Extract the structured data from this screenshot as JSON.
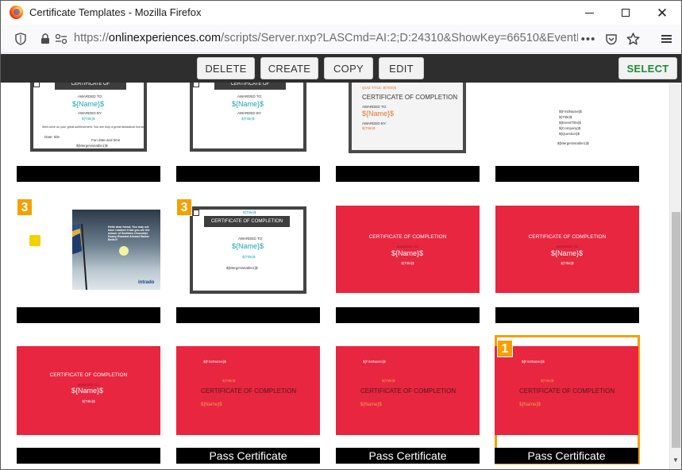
{
  "window": {
    "title": "Certificate Templates - Mozilla Firefox",
    "min_icon": "minimize-icon",
    "max_icon": "maximize-icon",
    "close_icon": "close-icon"
  },
  "navbar": {
    "url_prefix": "https://",
    "url_host": "onlinexperiences.com",
    "url_path": "/scripts/Server.nxp?LASCmd=AI:2;D:24310&ShowKey=66510&EventKey=N",
    "more": "•••"
  },
  "toolbar": {
    "delete": "DELETE",
    "create": "CREATE",
    "copy": "COPY",
    "edit": "EDIT",
    "select": "SELECT"
  },
  "colors": {
    "red_template": "#e8263f",
    "badge": "#f5a000",
    "toolbar": "#2e2e2e",
    "select_text": "#1f8a3a"
  },
  "tiles": {
    "r1c1": {
      "cert_title": "CERTIFICATE OF COMPLETION",
      "awarded": "AWARDED TO:",
      "name": "${Name}$",
      "by": "AWARDED BY",
      "title": "${Title}$",
      "body": "Well done on your great achievement. You are truly a great fantastical human.",
      "merge": "${MergeVariable1}$",
      "date": "Date: title",
      "fun": "Fun date and time"
    },
    "r1c2": {
      "cert_title": "CERTIFICATE OF COMPLETION",
      "awarded": "AWARDED TO:",
      "name": "${Name}$",
      "by": "AWARDED BY",
      "title": "${Title}$"
    },
    "r1c3": {
      "quiz": "QUIZ TITLE: ${Title}$",
      "cert_title": "CERTIFICATE OF COMPLETION",
      "awarded": "AWARDED TO:",
      "name": "${Name}$",
      "by": "AWARDED BY:",
      "title": "${Title}$"
    },
    "r1c4": {
      "lines": [
        "${FirstName}$",
        "${Title}$",
        "${EventTitle}$",
        "${Company}$",
        "${Question}$"
      ],
      "merge": "${MergeVariable1}$"
    },
    "r2c1": {
      "badge": "3",
      "text": "Hello dear friend, You may not have realized it but you are the winner of Smithies Chocolate Honey Roasted Almond Butter Bells!!!",
      "brand": "intrado"
    },
    "r2c2": {
      "badge": "3",
      "cert_title": "CERTIFICATE OF COMPLETION",
      "awarded": "AWARDED TO:",
      "name": "${Name}$",
      "title": "${Title}$",
      "merge": "${MergeVariable1}$"
    },
    "r2c3": {
      "cert_title": "CERTIFICATE OF COMPLETION",
      "awarded": "AWARDED TO:",
      "name": "${Name}$",
      "title": "${Title}$"
    },
    "r2c4": {
      "cert_title": "CERTIFICATE OF COMPLETION",
      "awarded": "AWARDED TO:",
      "name": "${Name}$",
      "title": "${Title}$"
    },
    "r3c1": {
      "cert_title": "CERTIFICATE OF COMPLETION",
      "awarded": "AWARDED TO:",
      "name": "${Name}$",
      "title": "${Title}$"
    },
    "r3c2": {
      "first": "${FirstName}$",
      "title": "${Title}$",
      "cert_title": "CERTIFICATE OF COMPLETION",
      "name": "${Name}$",
      "label": "Pass Certificate"
    },
    "r3c3": {
      "first": "${FirstName}$",
      "title": "${Title}$",
      "cert_title": "CERTIFICATE OF COMPLETION",
      "name": "${Name}$",
      "label": "Pass Certificate"
    },
    "r3c4": {
      "badge": "1",
      "first": "${FirstName}$",
      "title": "${Title}$",
      "cert_title": "CERTIFICATE OF COMPLETION",
      "name": "${Name}$",
      "label": "Pass Certificate"
    }
  }
}
